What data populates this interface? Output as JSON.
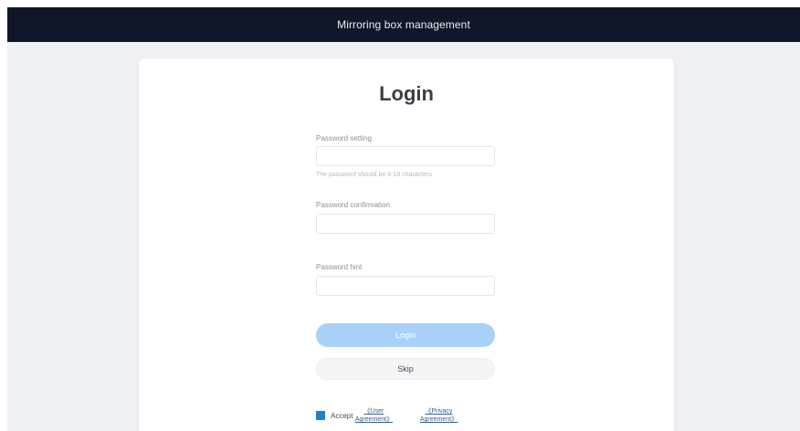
{
  "header": {
    "title": "Mirroring box management"
  },
  "login": {
    "title": "Login",
    "password_setting_label": "Password setting",
    "password_setting_value": "",
    "password_hint_text": "The password should be 6-18 characters",
    "password_confirmation_label": "Password confirmation",
    "password_confirmation_value": "",
    "password_hint_label": "Password hint",
    "password_hint_value": "",
    "login_button": "Login",
    "skip_button": "Skip"
  },
  "agreement": {
    "accept_label": "Accept",
    "user_agreement_link": "《User Agreement》",
    "privacy_agreement_link": "《Privacy Agreement》",
    "checked": true
  },
  "colors": {
    "topbar": "#101728",
    "background": "#eef0f3",
    "primary_button_disabled": "#a9d1f7",
    "checkbox": "#1f7fd6"
  }
}
